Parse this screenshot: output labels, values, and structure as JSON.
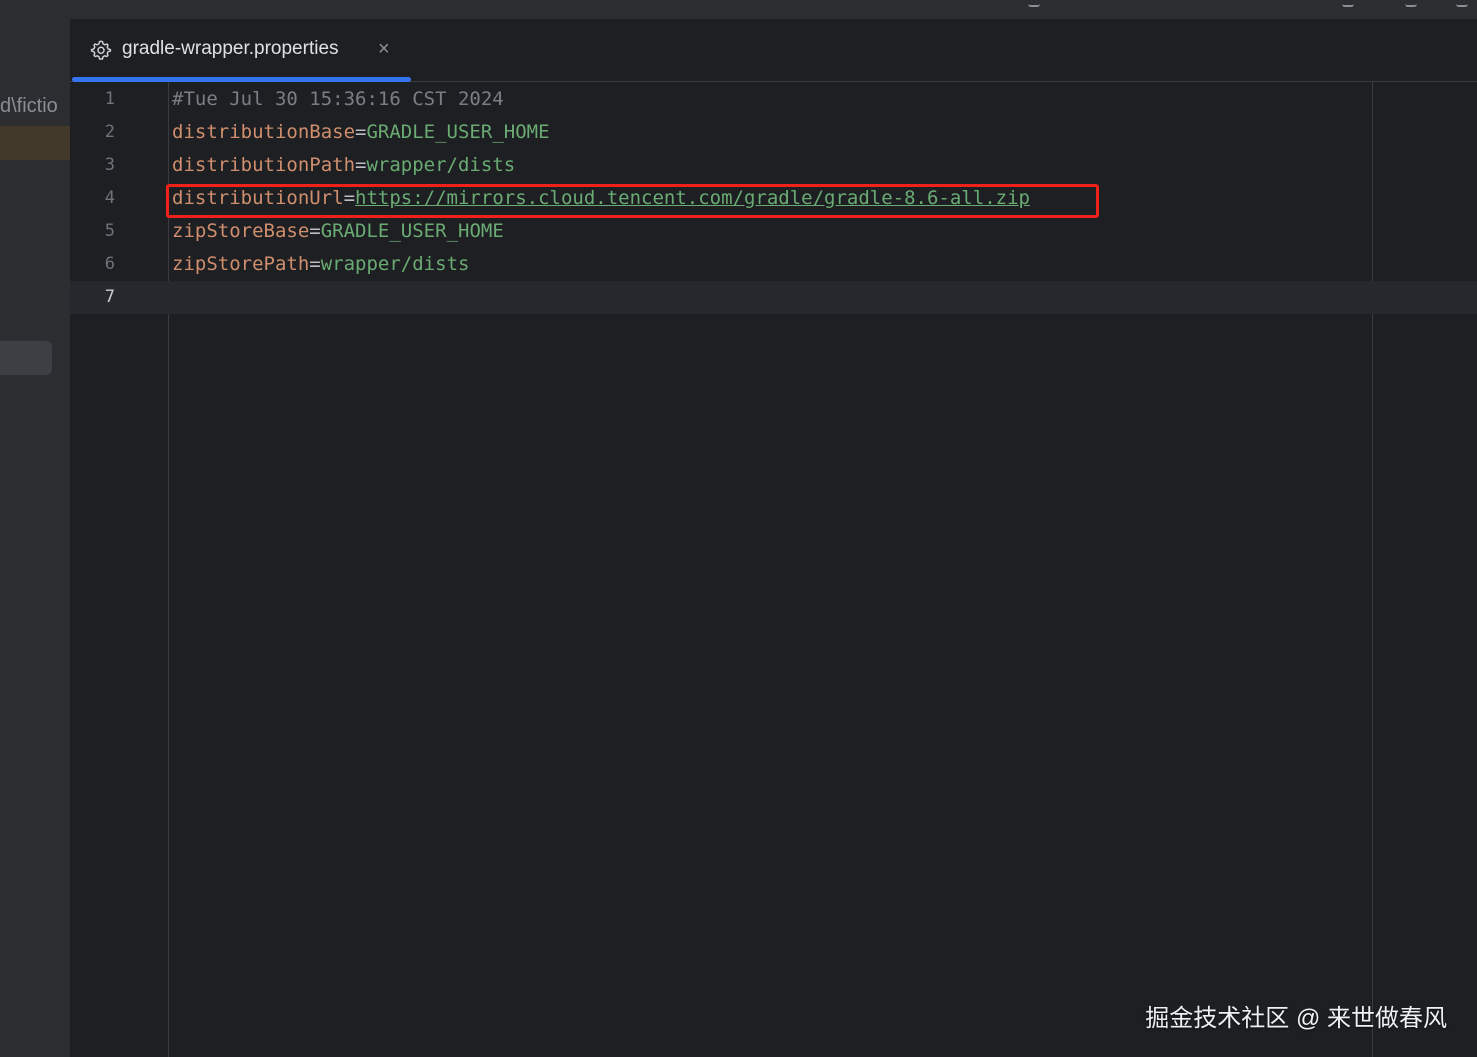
{
  "sidebar": {
    "path_fragment": "d\\fictio"
  },
  "tab": {
    "icon": "gear-icon",
    "title": "gradle-wrapper.properties",
    "close_glyph": "×"
  },
  "editor": {
    "current_line": 7,
    "lines": [
      {
        "number": "1",
        "comment": "#Tue Jul 30 15:36:16 CST 2024"
      },
      {
        "number": "2",
        "key": "distributionBase",
        "eq": "=",
        "value": "GRADLE_USER_HOME"
      },
      {
        "number": "3",
        "key": "distributionPath",
        "eq": "=",
        "value": "wrapper/dists"
      },
      {
        "number": "4",
        "key": "distributionUrl",
        "eq": "=",
        "url": "https://mirrors.cloud.tencent.com/gradle/gradle-8.6-all.zip"
      },
      {
        "number": "5",
        "key": "zipStoreBase",
        "eq": "=",
        "value": "GRADLE_USER_HOME"
      },
      {
        "number": "6",
        "key": "zipStorePath",
        "eq": "=",
        "value": "wrapper/dists"
      },
      {
        "number": "7"
      }
    ]
  },
  "colors": {
    "accent": "#3574f0",
    "highlight": "#f0201a",
    "key": "#cf8e6d",
    "value": "#6aab73",
    "comment": "#7a7e85"
  },
  "watermark": "掘金技术社区 @ 来世做春风"
}
